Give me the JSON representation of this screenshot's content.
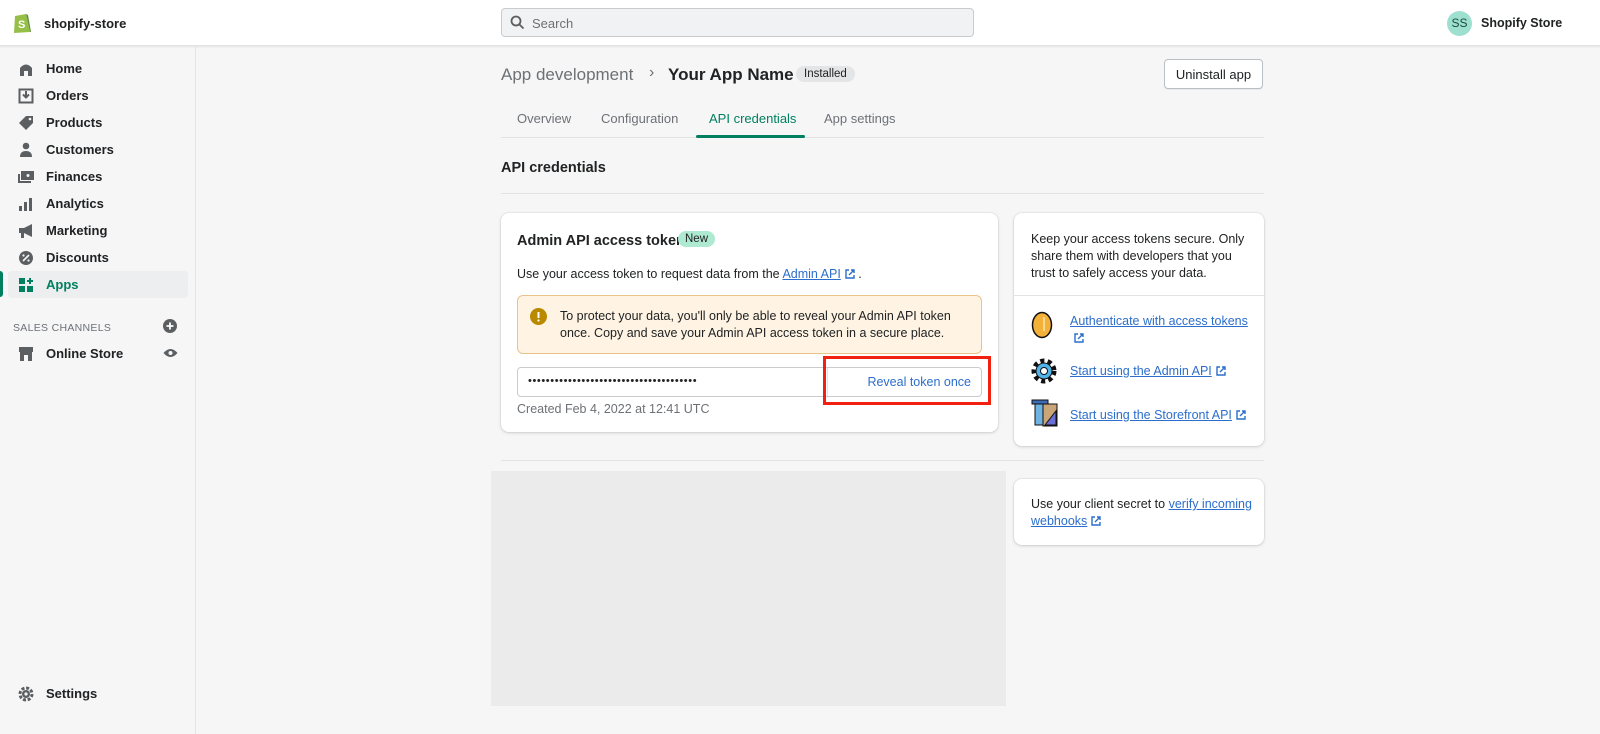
{
  "topbar": {
    "store_name": "shopify-store",
    "search_placeholder": "Search",
    "user_initials": "SS",
    "user_name": "Shopify Store"
  },
  "sidebar": {
    "items": [
      {
        "label": "Home",
        "icon": "home-icon"
      },
      {
        "label": "Orders",
        "icon": "orders-icon"
      },
      {
        "label": "Products",
        "icon": "tag-icon"
      },
      {
        "label": "Customers",
        "icon": "person-icon"
      },
      {
        "label": "Finances",
        "icon": "finances-icon"
      },
      {
        "label": "Analytics",
        "icon": "bar-chart-icon"
      },
      {
        "label": "Marketing",
        "icon": "megaphone-icon"
      },
      {
        "label": "Discounts",
        "icon": "discount-icon"
      },
      {
        "label": "Apps",
        "icon": "apps-icon",
        "active": true
      }
    ],
    "sales_channels_label": "SALES CHANNELS",
    "online_store": "Online Store",
    "settings": "Settings"
  },
  "header": {
    "breadcrumb": "App development",
    "title": "Your App Name",
    "status_badge": "Installed",
    "uninstall_label": "Uninstall app"
  },
  "tabs": [
    {
      "label": "Overview"
    },
    {
      "label": "Configuration"
    },
    {
      "label": "API credentials",
      "active": true
    },
    {
      "label": "App settings"
    }
  ],
  "section_title": "API credentials",
  "token_card": {
    "title": "Admin API access token",
    "badge": "New",
    "desc_prefix": "Use your access token to request data from the",
    "desc_link": "Admin API",
    "desc_suffix": ".",
    "warning": "To protect your data, you'll only be able to reveal your Admin API token once. Copy and save your Admin API access token in a secure place.",
    "masked_token": "••••••••••••••••••••••••••••••••••••••",
    "reveal_label": "Reveal token once",
    "created": "Created Feb 4, 2022 at 12:41 UTC"
  },
  "side_card": {
    "note": "Keep your access tokens secure. Only share them with developers that you trust to safely access your data.",
    "links": [
      {
        "label": "Authenticate with access tokens",
        "icon": "coin-icon"
      },
      {
        "label": "Start using the Admin API",
        "icon": "gear-icon"
      },
      {
        "label": "Start using the Storefront API",
        "icon": "storefront-icon"
      }
    ]
  },
  "webhook_card": {
    "prefix": "Use your client secret to",
    "link": "verify incoming webhooks"
  },
  "colors": {
    "accent": "#008060",
    "link": "#2c6ecb",
    "highlight": "#f2200f"
  }
}
